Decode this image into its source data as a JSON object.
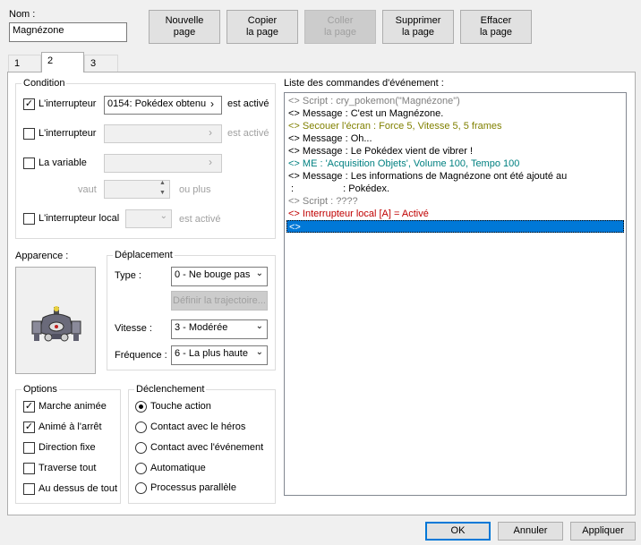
{
  "header": {
    "name_label": "Nom :",
    "name_value": "Magnézone",
    "buttons": [
      {
        "label1": "Nouvelle",
        "label2": "page"
      },
      {
        "label1": "Copier",
        "label2": "la page"
      },
      {
        "label1": "Coller",
        "label2": "la page"
      },
      {
        "label1": "Supprimer",
        "label2": "la page"
      },
      {
        "label1": "Effacer",
        "label2": "la page"
      }
    ]
  },
  "tabs": [
    "1",
    "2",
    "3"
  ],
  "condition": {
    "title": "Condition",
    "switch1": {
      "label": "L'interrupteur",
      "value": "0154: Pokédex obtenu",
      "suffix": "est activé",
      "checked": true
    },
    "switch2": {
      "label": "L'interrupteur",
      "value": "",
      "suffix": "est activé",
      "checked": false
    },
    "variable": {
      "label": "La variable",
      "value": "",
      "checked": false
    },
    "vaut_label": "vaut",
    "ou_plus": "ou plus",
    "local_switch": {
      "label": "L'interrupteur local",
      "value": "",
      "suffix": "est activé",
      "checked": false
    }
  },
  "appearance": {
    "title": "Apparence :"
  },
  "movement": {
    "title": "Déplacement",
    "type_label": "Type :",
    "type_value": "0 - Ne bouge pas",
    "define_button": "Définir la trajectoire...",
    "speed_label": "Vitesse :",
    "speed_value": "3 - Modérée",
    "freq_label": "Fréquence :",
    "freq_value": "6 - La plus haute"
  },
  "options": {
    "title": "Options",
    "items": [
      {
        "label": "Marche animée",
        "checked": true
      },
      {
        "label": "Animé à l'arrêt",
        "checked": true
      },
      {
        "label": "Direction fixe",
        "checked": false
      },
      {
        "label": "Traverse tout",
        "checked": false
      },
      {
        "label": "Au dessus de tout",
        "checked": false
      }
    ]
  },
  "trigger": {
    "title": "Déclenchement",
    "items": [
      {
        "label": "Touche action",
        "selected": true
      },
      {
        "label": "Contact avec le héros",
        "selected": false
      },
      {
        "label": "Contact avec l'événement",
        "selected": false
      },
      {
        "label": "Automatique",
        "selected": false
      },
      {
        "label": "Processus parallèle",
        "selected": false
      }
    ]
  },
  "commands": {
    "title": "Liste des commandes d'événement :",
    "lines": [
      {
        "text": "<> Script : cry_pokemon(\"Magnézone\")",
        "color": "#808080"
      },
      {
        "text": "<> Message : C'est un Magnézone.",
        "color": "#000000"
      },
      {
        "text": "<> Secouer l'écran : Force 5, Vitesse 5, 5 frames",
        "color": "#808000"
      },
      {
        "text": "<> Message : Oh...",
        "color": "#000000"
      },
      {
        "text": "<> Message : Le Pokédex vient de vibrer !",
        "color": "#000000"
      },
      {
        "text": "<> ME : 'Acquisition Objets', Volume 100, Tempo 100",
        "color": "#008080"
      },
      {
        "text": "<> Message : Les informations de Magnézone ont été ajouté au",
        "color": "#000000"
      },
      {
        "text": " :                  : Pokédex.",
        "color": "#000000"
      },
      {
        "text": "<> Script : ????",
        "color": "#808080"
      },
      {
        "text": "<> Interrupteur local [A] = Activé",
        "color": "#c00000"
      },
      {
        "text": "<>",
        "color": "#ffffff"
      }
    ]
  },
  "footer": {
    "ok": "OK",
    "cancel": "Annuler",
    "apply": "Appliquer"
  }
}
